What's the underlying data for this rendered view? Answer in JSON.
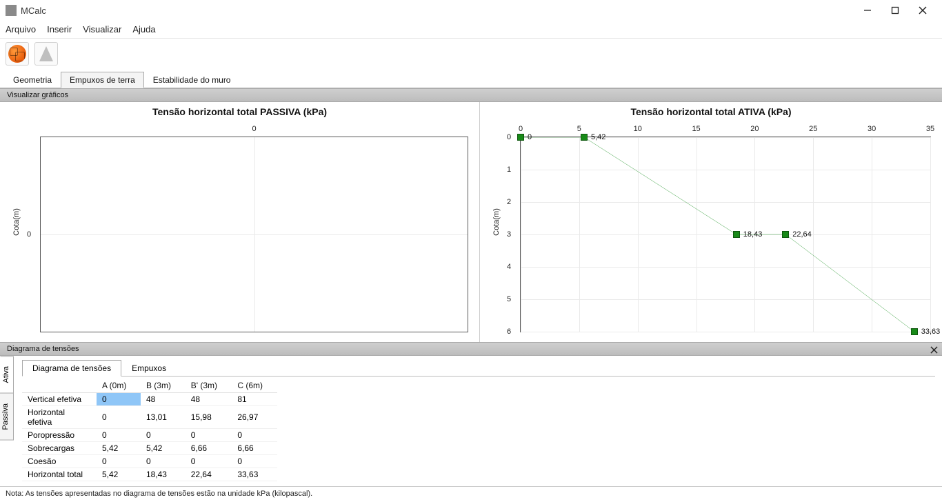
{
  "window": {
    "title": "MCalc"
  },
  "menu": [
    "Arquivo",
    "Inserir",
    "Visualizar",
    "Ajuda"
  ],
  "toolbar": {
    "icon1_name": "soil-texture-icon",
    "icon2_name": "wall-cone-icon"
  },
  "main_tabs": {
    "items": [
      "Geometria",
      "Empuxos de terra",
      "Estabilidade do muro"
    ],
    "active_index": 1
  },
  "sections": {
    "charts_hdr": "Visualizar gráficos",
    "diagram_hdr": "Diagrama de tensões"
  },
  "chart_data": [
    {
      "type": "line",
      "title": "Tensão horizontal total PASSIVA (kPa)",
      "ylabel": "Cota(m)",
      "x_ticks": [
        0
      ],
      "y_ticks": [
        0
      ],
      "series": []
    },
    {
      "type": "line",
      "title": "Tensão horizontal total ATIVA (kPa)",
      "ylabel": "Cota(m)",
      "x_ticks": [
        0,
        5,
        10,
        15,
        20,
        25,
        30,
        35
      ],
      "y_ticks": [
        0,
        1,
        2,
        3,
        4,
        5,
        6
      ],
      "x_range": [
        0,
        35
      ],
      "y_range": [
        0,
        6
      ],
      "series": [
        {
          "name": "Ativa",
          "points": [
            {
              "x": 0,
              "y": 0,
              "label": "0"
            },
            {
              "x": 5.42,
              "y": 0,
              "label": "5,42"
            },
            {
              "x": 18.43,
              "y": 3,
              "label": "18,43"
            },
            {
              "x": 22.64,
              "y": 3,
              "label": "22,64"
            },
            {
              "x": 33.63,
              "y": 6,
              "label": "33,63"
            }
          ]
        }
      ]
    }
  ],
  "vertical_tabs": {
    "items": [
      "Ativa",
      "Passiva"
    ],
    "active_index": 0
  },
  "sub_tabs": {
    "items": [
      "Diagrama de tensões",
      "Empuxos"
    ],
    "active_index": 0
  },
  "table": {
    "columns": [
      "",
      "A (0m)",
      "B (3m)",
      "B' (3m)",
      "C (6m)"
    ],
    "rows": [
      {
        "label": "Vertical efetiva",
        "cells": [
          "0",
          "48",
          "48",
          "81"
        ],
        "selected_col": 0
      },
      {
        "label": "Horizontal efetiva",
        "cells": [
          "0",
          "13,01",
          "15,98",
          "26,97"
        ]
      },
      {
        "label": "Poropressão",
        "cells": [
          "0",
          "0",
          "0",
          "0"
        ]
      },
      {
        "label": "Sobrecargas",
        "cells": [
          "5,42",
          "5,42",
          "6,66",
          "6,66"
        ]
      },
      {
        "label": "Coesão",
        "cells": [
          "0",
          "0",
          "0",
          "0"
        ]
      },
      {
        "label": "Horizontal total",
        "cells": [
          "5,42",
          "18,43",
          "22,64",
          "33,63"
        ]
      }
    ]
  },
  "footnote": "Nota: As tensões apresentadas no diagrama de tensões estão na unidade kPa (kilopascal)."
}
